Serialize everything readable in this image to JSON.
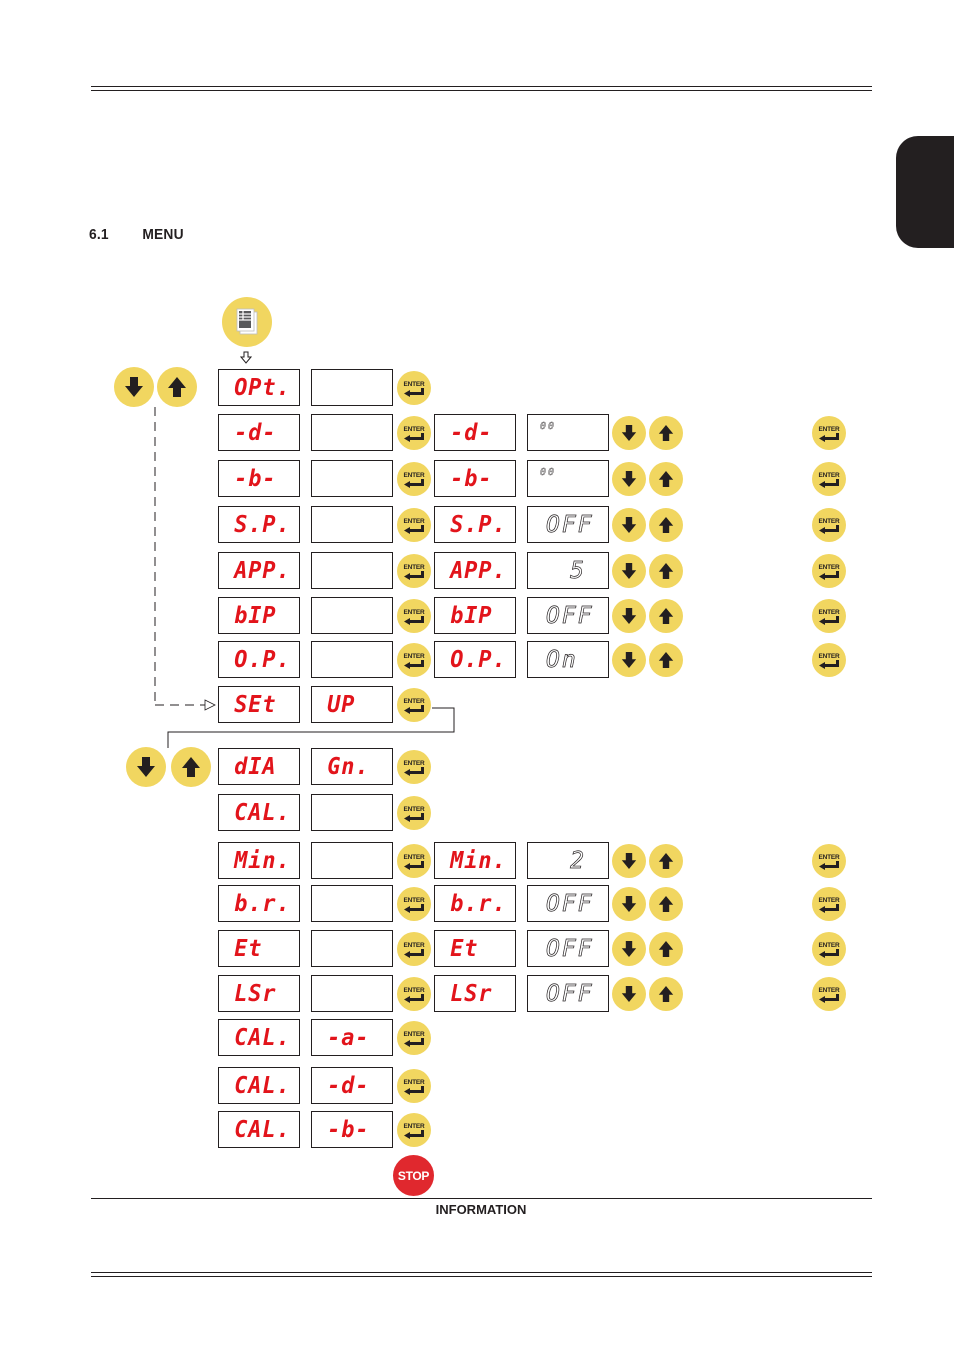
{
  "page": {
    "section_number": "6.1",
    "section_title": "MENU",
    "footer_label": "INFORMATION"
  },
  "colors": {
    "button_fill": "#f1d660",
    "display_text": "#e2141b",
    "stop_fill": "#e0282e",
    "ink": "#231f20"
  },
  "icons": {
    "menu": "menu-document-icon",
    "enter": "enter-return-icon",
    "down": "arrow-down-icon",
    "up": "arrow-up-icon",
    "stop": "stop-icon"
  },
  "buttons": {
    "enter_label": "ENTER",
    "stop_label": "STOP"
  },
  "menu": {
    "rows": [
      {
        "key": "OPt.",
        "sub": "",
        "edit_key": null,
        "edit_value": null
      },
      {
        "key": "-d-",
        "sub": "",
        "edit_key": "-d-",
        "edit_value": "00"
      },
      {
        "key": "-b-",
        "sub": "",
        "edit_key": "-b-",
        "edit_value": "00"
      },
      {
        "key": "S.P.",
        "sub": "",
        "edit_key": "S.P.",
        "edit_value": "OFF"
      },
      {
        "key": "APP.",
        "sub": "",
        "edit_key": "APP.",
        "edit_value": "5"
      },
      {
        "key": "bIP",
        "sub": "",
        "edit_key": "bIP",
        "edit_value": "OFF"
      },
      {
        "key": "O.P.",
        "sub": "",
        "edit_key": "O.P.",
        "edit_value": "On"
      },
      {
        "key": "SEt",
        "sub": "UP",
        "edit_key": null,
        "edit_value": null
      }
    ],
    "setup_rows": [
      {
        "key": "dIA",
        "sub": "Gn.",
        "edit_key": null,
        "edit_value": null
      },
      {
        "key": "CAL.",
        "sub": "",
        "edit_key": null,
        "edit_value": null
      },
      {
        "key": "Min.",
        "sub": "",
        "edit_key": "Min.",
        "edit_value": "2"
      },
      {
        "key": "b.r.",
        "sub": "",
        "edit_key": "b.r.",
        "edit_value": "OFF"
      },
      {
        "key": "Et",
        "sub": "",
        "edit_key": "Et",
        "edit_value": "OFF"
      },
      {
        "key": "LSr",
        "sub": "",
        "edit_key": "LSr",
        "edit_value": "OFF"
      },
      {
        "key": "CAL.",
        "sub": "-a-",
        "edit_key": null,
        "edit_value": null
      },
      {
        "key": "CAL.",
        "sub": "-d-",
        "edit_key": null,
        "edit_value": null
      },
      {
        "key": "CAL.",
        "sub": "-b-",
        "edit_key": null,
        "edit_value": null
      }
    ]
  }
}
